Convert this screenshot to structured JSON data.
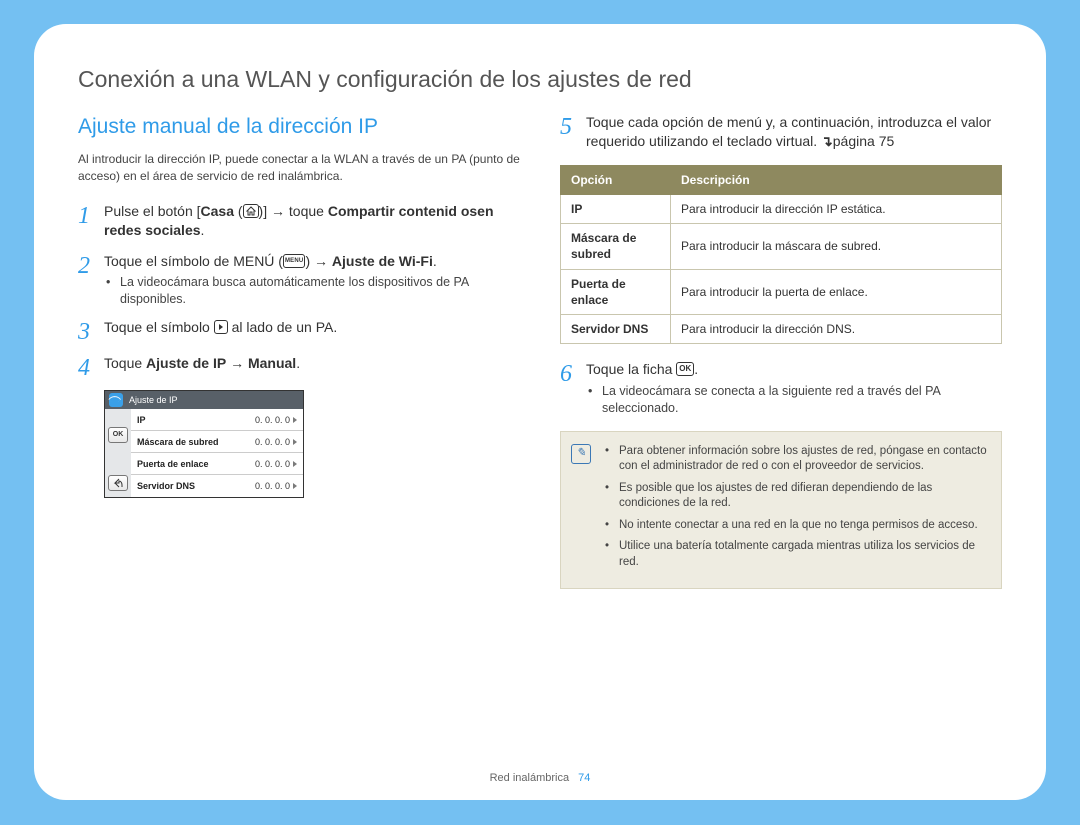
{
  "page": {
    "title": "Conexión a una WLAN y configuración de los ajustes de red",
    "section_title": "Ajuste manual de la dirección IP",
    "intro": "Al introducir la dirección IP, puede conectar a la WLAN a través de un PA (punto de acceso) en el área de servicio de red inalámbrica.",
    "footer_section": "Red inalámbrica",
    "footer_page": "74"
  },
  "steps": {
    "s1_a": "Pulse el botón [",
    "s1_b": "Casa",
    "s1_c": " (",
    "s1_d": ")] ",
    "s1_e": " toque ",
    "s1_f": "Compartir contenid osen redes sociales",
    "s1_g": ".",
    "s2_a": "Toque el símbolo de MENÚ (",
    "s2_b": ") ",
    "s2_c": "Ajuste de Wi-Fi",
    "s2_d": ".",
    "s2_bullet": "La videocámara busca automáticamente los dispositivos de PA disponibles.",
    "s3_a": "Toque el símbolo ",
    "s3_b": " al lado de un PA.",
    "s4_a": "Toque ",
    "s4_b": "Ajuste de IP",
    "s4_c": "Manual",
    "s4_d": ".",
    "s5_a": "Toque cada opción de menú y, a continuación, introduzca el valor requerido utilizando el teclado virtual. ",
    "s5_b": "página 75",
    "s6_a": "Toque la ficha ",
    "s6_b": ".",
    "s6_bullet": "La videocámara se conecta a la siguiente red a través del PA seleccionado."
  },
  "device": {
    "title": "Ajuste de IP",
    "ok": "OK",
    "rows": [
      {
        "label": "IP",
        "value": "0. 0. 0. 0"
      },
      {
        "label": "Máscara de subred",
        "value": "0. 0. 0. 0"
      },
      {
        "label": "Puerta de enlace",
        "value": "0. 0. 0. 0"
      },
      {
        "label": "Servidor DNS",
        "value": "0. 0. 0. 0"
      }
    ]
  },
  "table": {
    "h1": "Opción",
    "h2": "Descripción",
    "rows": [
      {
        "opt": "IP",
        "desc": "Para introducir la dirección IP estática."
      },
      {
        "opt": "Máscara de subred",
        "desc": "Para introducir la máscara de subred."
      },
      {
        "opt": "Puerta de enlace",
        "desc": "Para introducir la puerta de enlace."
      },
      {
        "opt": "Servidor DNS",
        "desc": "Para introducir la dirección DNS."
      }
    ]
  },
  "note": {
    "items": [
      "Para obtener información sobre los ajustes de red, póngase en contacto con el administrador de red o con el proveedor de servicios.",
      "Es posible que los ajustes de red difieran dependiendo de las condiciones de la red.",
      "No intente conectar a una red en la que no tenga permisos de acceso.",
      "Utilice una batería totalmente cargada mientras utiliza los servicios de red."
    ]
  },
  "icons": {
    "menu_label": "MENU",
    "ok_label": "OK"
  }
}
